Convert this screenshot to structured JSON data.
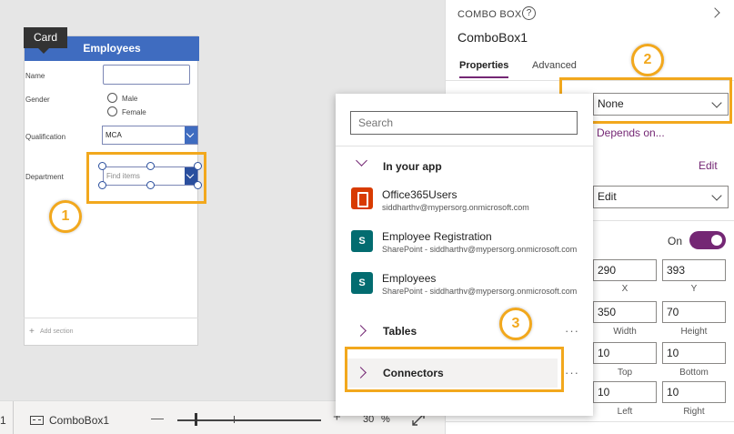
{
  "canvas": {
    "tooltip": "Card",
    "form_title": "Employees",
    "fields": {
      "name_label": "Name",
      "gender_label": "Gender",
      "gender_options": [
        "Male",
        "Female"
      ],
      "qualification_label": "Qualification",
      "qualification_value": "MCA",
      "department_label": "Department",
      "department_placeholder": "Find items"
    },
    "add_section": "Add section"
  },
  "callouts": [
    "1",
    "2",
    "3"
  ],
  "bottombar": {
    "screen_number": "1",
    "selected_component": "ComboBox1",
    "zoom_minus": "—",
    "zoom_plus": "+",
    "zoom_value": "30",
    "zoom_unit": "%",
    "fit_icon": "fit-to-window-icon"
  },
  "panel": {
    "control_type": "COMBO BOX",
    "help": "?",
    "control_name": "ComboBox1",
    "tabs": [
      "Properties",
      "Advanced"
    ],
    "items_value": "None",
    "depends_on": "Depends on...",
    "edit_link": "Edit",
    "display_mode": "Edit",
    "visible_state": "On",
    "position": {
      "x": "290",
      "y": "393",
      "x_label": "X",
      "y_label": "Y"
    },
    "size": {
      "width": "350",
      "height": "70",
      "width_label": "Width",
      "height_label": "Height"
    },
    "padding": {
      "top": "10",
      "bottom": "10",
      "left": "10",
      "right": "10",
      "top_label": "Top",
      "bottom_label": "Bottom",
      "left_label": "Left",
      "right_label": "Right"
    },
    "accent": "#742774"
  },
  "flyout": {
    "search_placeholder": "Search",
    "section_in_app": "In your app",
    "sources": [
      {
        "title": "Office365Users",
        "subtitle": "siddharthv@mypersorg.onmicrosoft.com",
        "icon": "office365-icon"
      },
      {
        "title": "Employee Registration",
        "subtitle": "SharePoint - siddharthv@mypersorg.onmicrosoft.com",
        "icon": "sharepoint-icon"
      },
      {
        "title": "Employees",
        "subtitle": "SharePoint - siddharthv@mypersorg.onmicrosoft.com",
        "icon": "sharepoint-icon"
      }
    ],
    "tables": "Tables",
    "connectors": "Connectors",
    "more": "···"
  },
  "highlight_color": "#f2a81d"
}
